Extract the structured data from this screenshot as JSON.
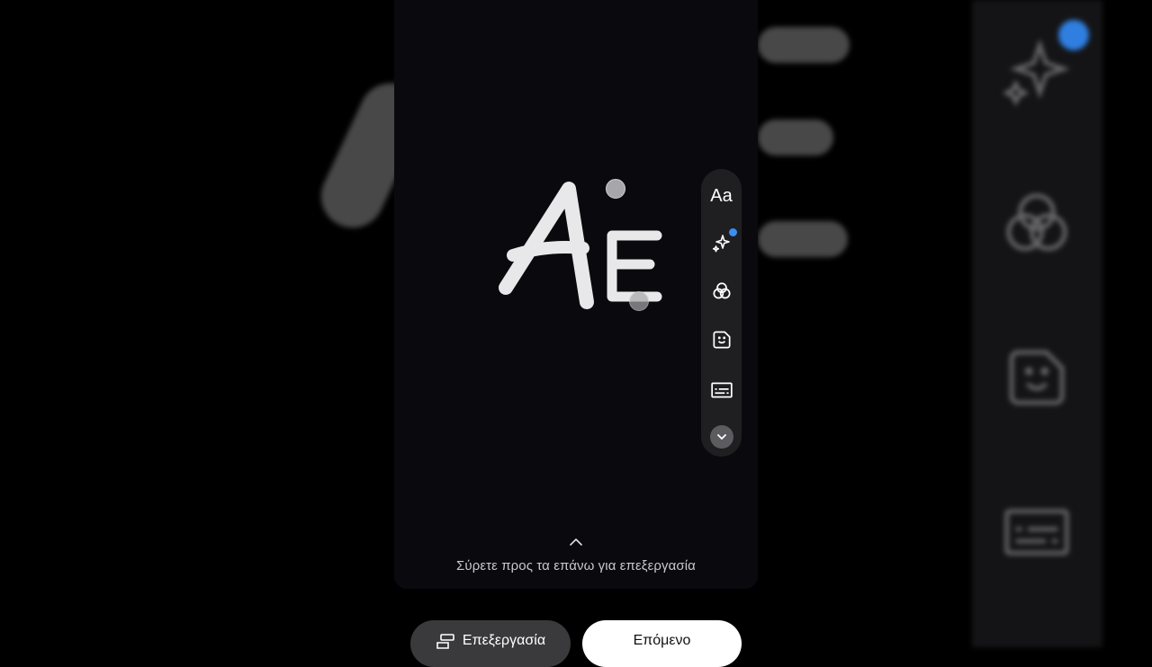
{
  "canvas": {
    "text_art": [
      "A",
      "E"
    ]
  },
  "toolbar": {
    "items": [
      {
        "name": "text",
        "label": "Aa",
        "icon": "text-icon"
      },
      {
        "name": "effects",
        "icon": "sparkle-icon",
        "badge": true
      },
      {
        "name": "filters",
        "icon": "filters-icon"
      },
      {
        "name": "stickers",
        "icon": "sticker-icon"
      },
      {
        "name": "captions",
        "icon": "captions-icon"
      },
      {
        "name": "more",
        "icon": "chevron-down-icon"
      }
    ]
  },
  "hint": {
    "icon": "chevron-up-icon",
    "text": "Σύρετε προς τα επάνω για επεξεργασία"
  },
  "actions": {
    "edit_label": "Επεξεργασία",
    "next_label": "Επόμενο"
  },
  "colors": {
    "background": "#000000",
    "canvas": "#0a090d",
    "toolbar": "#1f1f22",
    "badge": "#3a8ff0",
    "primary_button": "#ffffff",
    "secondary_button": "#3a3a3d"
  }
}
